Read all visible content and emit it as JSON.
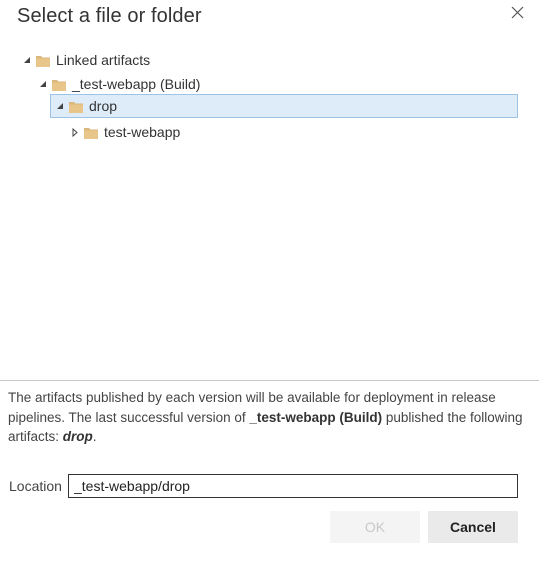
{
  "dialog": {
    "title": "Select a file or folder"
  },
  "tree": {
    "items": [
      {
        "label": "Linked artifacts",
        "expanded": true,
        "level": 0
      },
      {
        "label": "_test-webapp (Build)",
        "expanded": true,
        "level": 1
      },
      {
        "label": "drop",
        "expanded": true,
        "level": 2,
        "selected": true
      },
      {
        "label": "test-webapp",
        "expanded": false,
        "level": 3
      }
    ]
  },
  "info": {
    "text1": "The artifacts published by each version will be available for deployment in release pipelines. The last successful version of ",
    "build_name": "_test-webapp (Build)",
    "text2": " published the following artifacts: ",
    "artifacts": "drop",
    "text3": "."
  },
  "location": {
    "label": "Location",
    "value": "_test-webapp/drop"
  },
  "buttons": {
    "ok_label": "OK",
    "cancel_label": "Cancel"
  },
  "colors": {
    "folder": "#dcb67a",
    "selection_bg": "#deecf9",
    "selection_border": "#9dc3e6"
  }
}
